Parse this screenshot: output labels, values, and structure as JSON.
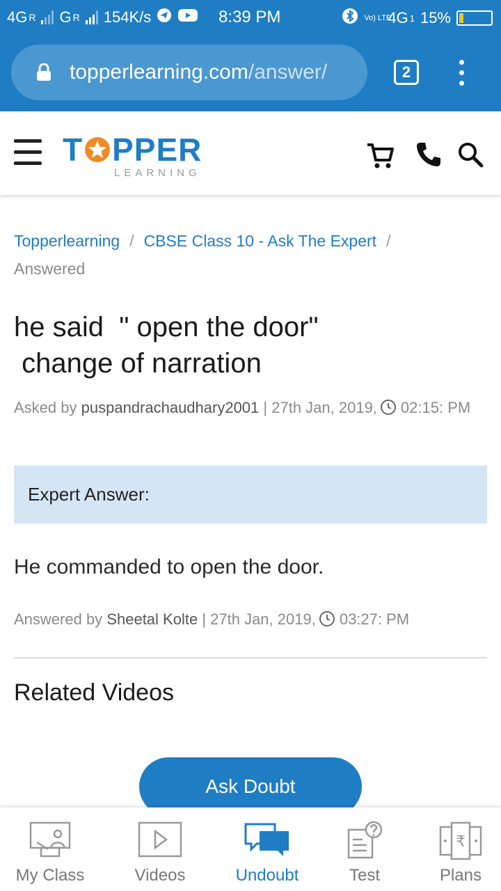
{
  "status_bar": {
    "network_left": "4G",
    "network_mid": "G",
    "roaming": "R",
    "speed": "154K/s",
    "time": "8:39 PM",
    "volte": "Vo) LTE",
    "network_right": "4G",
    "sim_index": "1",
    "battery": "15%",
    "battery_color": "#f3c623"
  },
  "browser": {
    "url_domain": "topperlearning.com",
    "url_path": "/answer/",
    "tab_count": "2"
  },
  "header": {
    "logo_top_left": "T",
    "logo_top_right": "PPER",
    "logo_bottom": "LEARNING",
    "icons": [
      "menu-icon",
      "cart-icon",
      "phone-icon",
      "search-icon"
    ]
  },
  "breadcrumb": {
    "items": [
      "Topperlearning",
      "CBSE Class 10 - Ask The Expert"
    ],
    "separator": "/",
    "current": "Answered"
  },
  "question": {
    "title": "he said  \" open the door\"\n change of narration",
    "asked_prefix": "Asked by",
    "asked_by": "puspandrachaudhary2001",
    "asked_date": "| 27th Jan, 2019,",
    "asked_time": "02:15: PM"
  },
  "answer": {
    "label": "Expert Answer:",
    "text": "He commanded to open the door.",
    "answered_prefix": "Answered by",
    "answered_by": "Sheetal Kolte",
    "answered_date": "| 27th Jan, 2019,",
    "answered_time": "03:27: PM"
  },
  "related": {
    "title": "Related Videos"
  },
  "cta": {
    "ask_doubt": "Ask Doubt"
  },
  "bottom_nav": {
    "items": [
      {
        "label": "My Class",
        "icon": "classroom-icon"
      },
      {
        "label": "Videos",
        "icon": "video-play-icon"
      },
      {
        "label": "Undoubt",
        "icon": "chat-bubbles-icon"
      },
      {
        "label": "Test",
        "icon": "test-icon"
      },
      {
        "label": "Plans",
        "icon": "rupee-plans-icon"
      }
    ],
    "active_index": 2
  },
  "colors": {
    "brand_blue": "#1f7dc4",
    "expert_box": "#d4e6f4",
    "logo_orange": "#f08a24"
  }
}
